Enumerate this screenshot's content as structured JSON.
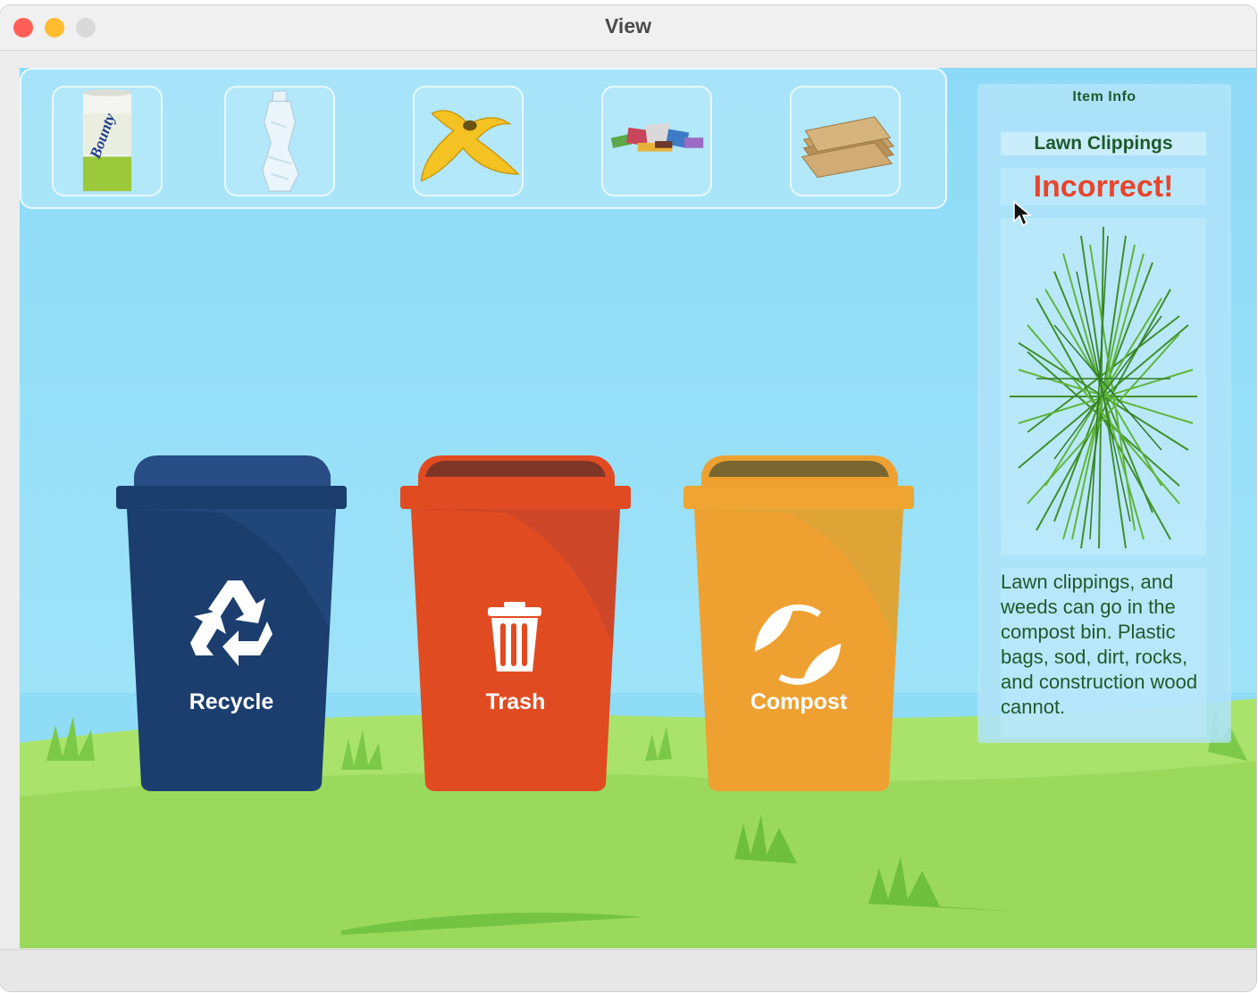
{
  "window": {
    "title": "View"
  },
  "tray": {
    "items": [
      {
        "name": "paper-towel-roll",
        "icon": "paper-towel-icon"
      },
      {
        "name": "plastic-bottle",
        "icon": "plastic-bottle-icon"
      },
      {
        "name": "banana-peel",
        "icon": "banana-peel-icon"
      },
      {
        "name": "mixed-trash",
        "icon": "mixed-trash-icon"
      },
      {
        "name": "cardboard",
        "icon": "cardboard-icon"
      }
    ],
    "paper_towel_brand": "Bounty"
  },
  "bins": [
    {
      "label": "Recycle",
      "color": "#1b3e6e",
      "icon": "recycle-icon"
    },
    {
      "label": "Trash",
      "color": "#e14b22",
      "icon": "trash-can-icon"
    },
    {
      "label": "Compost",
      "color": "#eea131",
      "icon": "compost-icon"
    }
  ],
  "info_panel": {
    "heading": "Item Info",
    "item_name": "Lawn Clippings",
    "result": "Incorrect!",
    "result_color": "#e8452d",
    "image_icon": "grass-clippings-icon",
    "description": "Lawn clippings, and weeds can go in the compost bin. Plastic bags, sod, dirt, rocks, and construction wood cannot."
  }
}
